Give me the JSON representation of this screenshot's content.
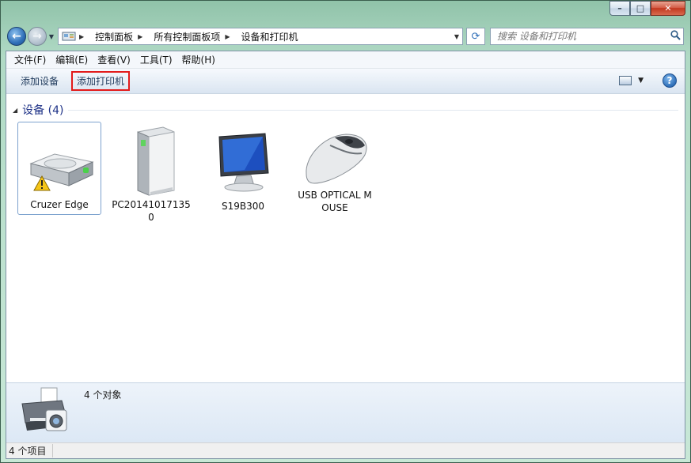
{
  "window": {
    "caption": {
      "minimize": "–",
      "maximize": "□",
      "close": "✕"
    }
  },
  "nav": {
    "back_glyph": "←",
    "forward_glyph": "→",
    "history_drop": "▼"
  },
  "address": {
    "crumbs": [
      {
        "label": "控制面板"
      },
      {
        "label": "所有控制面板项"
      },
      {
        "label": "设备和打印机"
      }
    ],
    "separator": "▶",
    "drop": "▼",
    "refresh": "⟳"
  },
  "search": {
    "placeholder": "搜索 设备和打印机",
    "icon": "search-icon"
  },
  "menubar": {
    "items": [
      "文件(F)",
      "编辑(E)",
      "查看(V)",
      "工具(T)",
      "帮助(H)"
    ]
  },
  "toolbar": {
    "add_device": "添加设备",
    "add_printer": "添加打印机",
    "view_drop": "▼",
    "help": "?",
    "highlight_color": "#e21b1b"
  },
  "group": {
    "collapse": "◢",
    "title": "设备 (4)"
  },
  "devices": [
    {
      "name": "Cruzer Edge",
      "icon": "usb-drive-warning-icon",
      "selected": true
    },
    {
      "name": "PC201410171350",
      "icon": "computer-tower-icon",
      "selected": false
    },
    {
      "name": "S19B300",
      "icon": "monitor-icon",
      "selected": false
    },
    {
      "name": "USB OPTICAL MOUSE",
      "icon": "mouse-icon",
      "selected": false
    }
  ],
  "details": {
    "count": "4 个对象",
    "icon": "printer-camera-icon"
  },
  "statusbar": {
    "text": "4 个项目"
  }
}
